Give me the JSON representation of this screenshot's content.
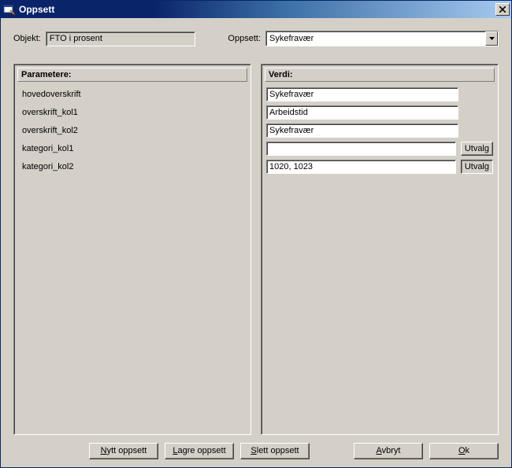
{
  "window": {
    "title": "Oppsett"
  },
  "top": {
    "objekt_label": "Objekt:",
    "objekt_value": "FTO i prosent",
    "oppsett_label": "Oppsett:",
    "oppsett_value": "Sykefravær"
  },
  "panels": {
    "param_header": "Parametere:",
    "value_header": "Verdi:"
  },
  "params": [
    {
      "name": "hovedoverskrift",
      "value": "Sykefravær",
      "has_utvalg": false
    },
    {
      "name": "overskrift_kol1",
      "value": "Arbeidstid",
      "has_utvalg": false
    },
    {
      "name": "overskrift_kol2",
      "value": "Sykefravær",
      "has_utvalg": false
    },
    {
      "name": "kategori_kol1",
      "value": "",
      "has_utvalg": true
    },
    {
      "name": "kategori_kol2",
      "value": "1020, 1023",
      "has_utvalg": true
    }
  ],
  "utvalg_label": "Utvalg",
  "buttons": {
    "nytt": "Nytt oppsett",
    "lagre": "Lagre oppsett",
    "slett": "Slett oppsett",
    "avbryt": "Avbryt",
    "ok": "Ok"
  }
}
